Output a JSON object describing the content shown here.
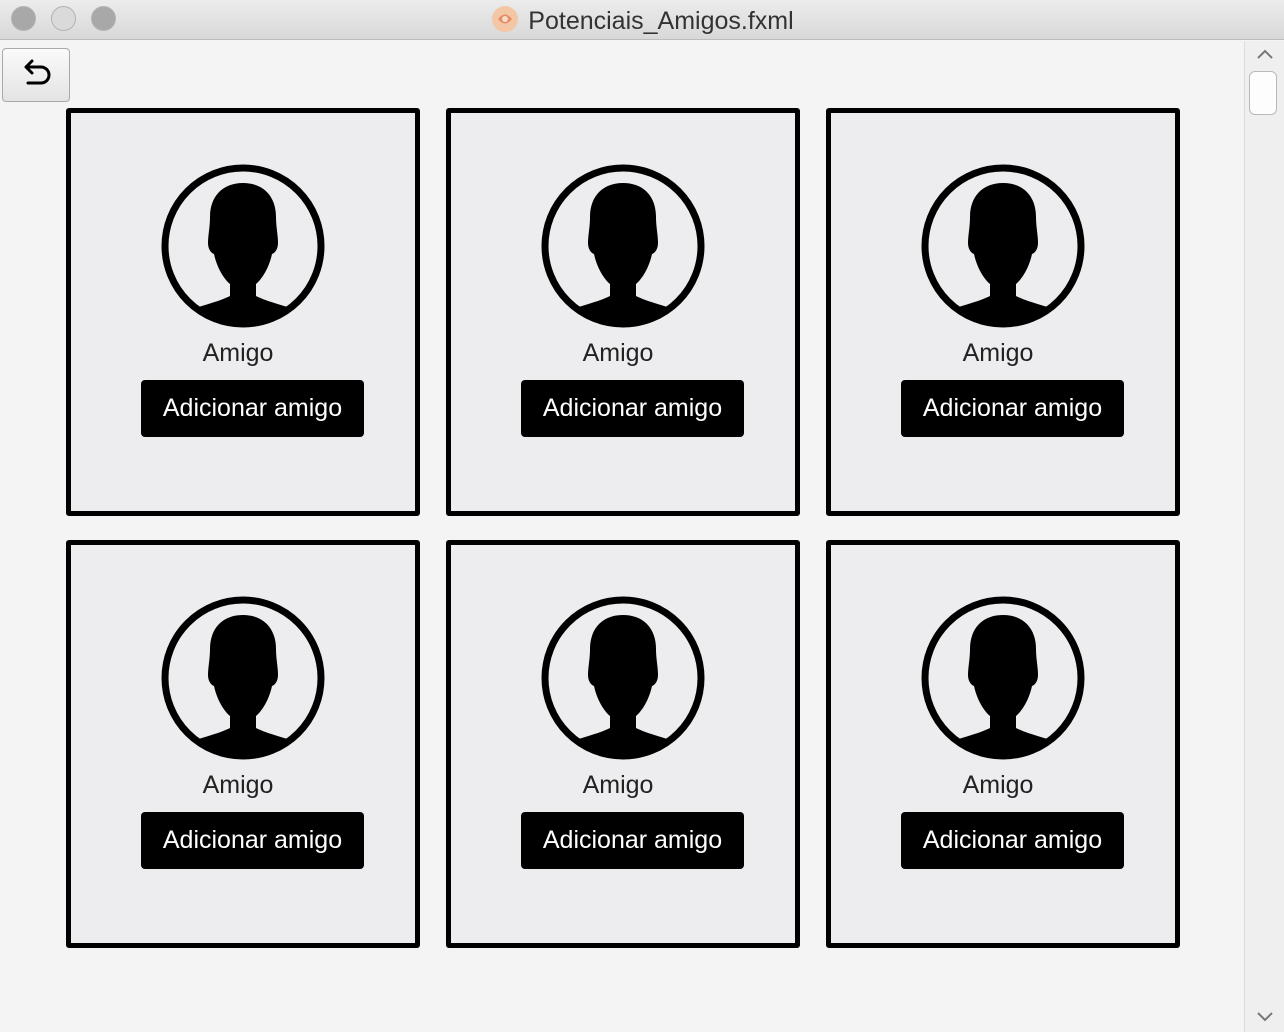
{
  "window": {
    "title": "Potenciais_Amigos.fxml"
  },
  "toolbar": {
    "back_icon": "undo-arrow-icon"
  },
  "friends": [
    {
      "name": "Amigo",
      "button_label": "Adicionar amigo",
      "avatar_icon": "user-avatar-icon"
    },
    {
      "name": "Amigo",
      "button_label": "Adicionar amigo",
      "avatar_icon": "user-avatar-icon"
    },
    {
      "name": "Amigo",
      "button_label": "Adicionar amigo",
      "avatar_icon": "user-avatar-icon"
    },
    {
      "name": "Amigo",
      "button_label": "Adicionar amigo",
      "avatar_icon": "user-avatar-icon"
    },
    {
      "name": "Amigo",
      "button_label": "Adicionar amigo",
      "avatar_icon": "user-avatar-icon"
    },
    {
      "name": "Amigo",
      "button_label": "Adicionar amigo",
      "avatar_icon": "user-avatar-icon"
    }
  ],
  "colors": {
    "card_background": "#ededef",
    "card_border": "#000000",
    "button_background": "#000000",
    "button_text": "#ffffff"
  }
}
